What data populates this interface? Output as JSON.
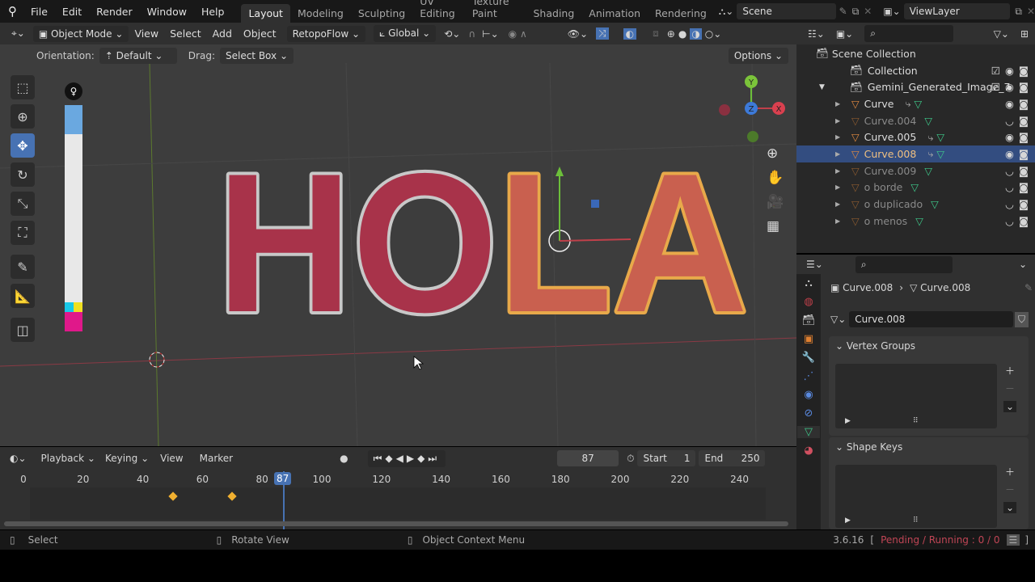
{
  "menu": [
    "File",
    "Edit",
    "Render",
    "Window",
    "Help"
  ],
  "workspaces": [
    "Layout",
    "Modeling",
    "Sculpting",
    "UV Editing",
    "Texture Paint",
    "Shading",
    "Animation",
    "Rendering"
  ],
  "scene": "Scene",
  "view_layer": "ViewLayer",
  "viewport_header": {
    "mode": "Object Mode",
    "items": [
      "View",
      "Select",
      "Add",
      "Object"
    ],
    "addon": "RetopoFlow",
    "transform": "Global"
  },
  "tool_settings": {
    "orientation_label": "Orientation:",
    "orientation": "Default",
    "drag_label": "Drag:",
    "drag": "Select Box",
    "options": "Options"
  },
  "viewport_text": "HOLA",
  "outliner": {
    "root": "Scene Collection",
    "rows": [
      {
        "name": "Collection",
        "level": 1,
        "vis": true
      },
      {
        "name": "Gemini_Generated_Image_7",
        "level": 1,
        "vis": true
      },
      {
        "name": "Curve",
        "level": 2,
        "vis": true,
        "mod": true
      },
      {
        "name": "Curve.004",
        "level": 2,
        "vis": false,
        "mod": false
      },
      {
        "name": "Curve.005",
        "level": 2,
        "vis": true,
        "mod": true
      },
      {
        "name": "Curve.008",
        "level": 2,
        "vis": true,
        "mod": true,
        "selected": true
      },
      {
        "name": "Curve.009",
        "level": 2,
        "vis": false,
        "mod": false
      },
      {
        "name": "o borde",
        "level": 2,
        "vis": false,
        "mod": false
      },
      {
        "name": "o duplicado",
        "level": 2,
        "vis": false,
        "mod": false
      },
      {
        "name": "o menos",
        "level": 2,
        "vis": false,
        "mod": false
      }
    ]
  },
  "properties": {
    "breadcrumb_object": "Curve.008",
    "breadcrumb_data": "Curve.008",
    "data_name": "Curve.008",
    "panels": [
      "Vertex Groups",
      "Shape Keys"
    ]
  },
  "timeline": {
    "menus": [
      "Playback",
      "Keying",
      "View",
      "Marker"
    ],
    "current_frame": 87,
    "start_label": "Start",
    "start": 1,
    "end_label": "End",
    "end": 250,
    "ticks": [
      0,
      20,
      40,
      60,
      80,
      100,
      120,
      140,
      160,
      180,
      200,
      220,
      240
    ],
    "keyframes": [
      50,
      70
    ]
  },
  "status": {
    "hints": [
      "Select",
      "Rotate View",
      "Object Context Menu"
    ],
    "version": "3.6.16",
    "bracket_open": "[",
    "jobs": "Pending / Running : 0 / 0",
    "bracket_close": "]"
  }
}
